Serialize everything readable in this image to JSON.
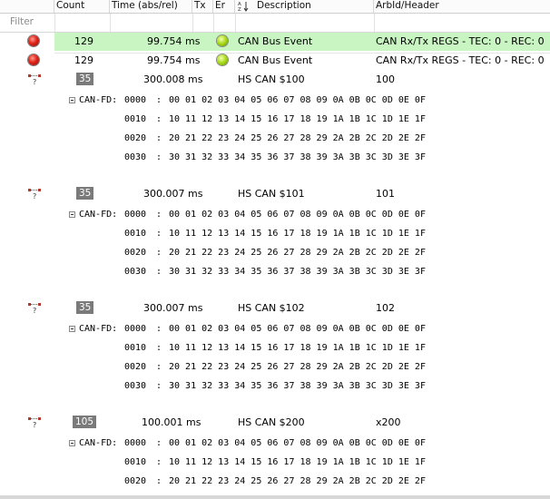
{
  "columns": [
    "Count",
    "Time (abs/rel)",
    "Tx",
    "Er",
    "Description",
    "ArbId/Header"
  ],
  "filter_label": "Filter",
  "status_rows": [
    {
      "count": "129",
      "time": "99.754 ms",
      "description": "CAN Bus Event",
      "arbid": "CAN Rx/Tx REGS - TEC: 0 - REC: 0",
      "selected": true
    },
    {
      "count": "129",
      "time": "99.754 ms",
      "description": "CAN Bus Event",
      "arbid": "CAN Rx/Tx REGS - TEC: 0 - REC: 0",
      "selected": false
    }
  ],
  "messages": [
    {
      "count": "35",
      "time": "300.008 ms",
      "description": "HS CAN $100",
      "arbid": "100",
      "frame_label": "CAN-FD:",
      "lines": [
        {
          "offset": "0000",
          "bytes": "00 01 02 03 04 05 06 07 08 09 0A 0B 0C 0D 0E 0F"
        },
        {
          "offset": "0010",
          "bytes": "10 11 12 13 14 15 16 17 18 19 1A 1B 1C 1D 1E 1F"
        },
        {
          "offset": "0020",
          "bytes": "20 21 22 23 24 25 26 27 28 29 2A 2B 2C 2D 2E 2F"
        },
        {
          "offset": "0030",
          "bytes": "30 31 32 33 34 35 36 37 38 39 3A 3B 3C 3D 3E 3F"
        }
      ]
    },
    {
      "count": "35",
      "time": "300.007 ms",
      "description": "HS CAN $101",
      "arbid": "101",
      "frame_label": "CAN-FD:",
      "lines": [
        {
          "offset": "0000",
          "bytes": "00 01 02 03 04 05 06 07 08 09 0A 0B 0C 0D 0E 0F"
        },
        {
          "offset": "0010",
          "bytes": "10 11 12 13 14 15 16 17 18 19 1A 1B 1C 1D 1E 1F"
        },
        {
          "offset": "0020",
          "bytes": "20 21 22 23 24 25 26 27 28 29 2A 2B 2C 2D 2E 2F"
        },
        {
          "offset": "0030",
          "bytes": "30 31 32 33 34 35 36 37 38 39 3A 3B 3C 3D 3E 3F"
        }
      ]
    },
    {
      "count": "35",
      "time": "300.007 ms",
      "description": "HS CAN $102",
      "arbid": "102",
      "frame_label": "CAN-FD:",
      "lines": [
        {
          "offset": "0000",
          "bytes": "00 01 02 03 04 05 06 07 08 09 0A 0B 0C 0D 0E 0F"
        },
        {
          "offset": "0010",
          "bytes": "10 11 12 13 14 15 16 17 18 19 1A 1B 1C 1D 1E 1F"
        },
        {
          "offset": "0020",
          "bytes": "20 21 22 23 24 25 26 27 28 29 2A 2B 2C 2D 2E 2F"
        },
        {
          "offset": "0030",
          "bytes": "30 31 32 33 34 35 36 37 38 39 3A 3B 3C 3D 3E 3F"
        }
      ]
    },
    {
      "count": "105",
      "time": "100.001 ms",
      "description": "HS CAN $200",
      "arbid": "x200",
      "frame_label": "CAN-FD:",
      "lines": [
        {
          "offset": "0000",
          "bytes": "00 01 02 03 04 05 06 07 08 09 0A 0B 0C 0D 0E 0F"
        },
        {
          "offset": "0010",
          "bytes": "10 11 12 13 14 15 16 17 18 19 1A 1B 1C 1D 1E 1F"
        },
        {
          "offset": "0020",
          "bytes": "20 21 22 23 24 25 26 27 28 29 2A 2B 2C 2D 2E 2F"
        }
      ]
    }
  ],
  "colors": {
    "selected_row": "#c9f5c3",
    "count_badge": "#7a7a7a"
  }
}
